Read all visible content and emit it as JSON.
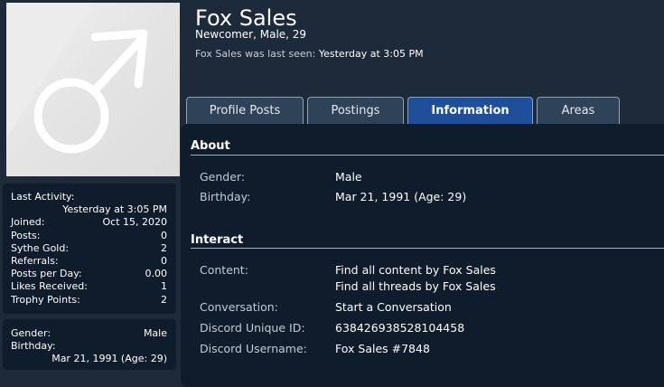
{
  "profile": {
    "name": "Fox Sales",
    "subtitle": "Newcomer, Male, 29",
    "last_seen_label": "Fox Sales was last seen:",
    "last_seen_value": "Yesterday at 3:05 PM",
    "avatar_icon": "male-symbol-icon"
  },
  "stats": {
    "last_activity_label": "Last Activity:",
    "last_activity_value": "Yesterday at 3:05 PM",
    "rows": [
      {
        "label": "Joined:",
        "value": "Oct 15, 2020"
      },
      {
        "label": "Posts:",
        "value": "0"
      },
      {
        "label": "Sythe Gold:",
        "value": "2"
      },
      {
        "label": "Referrals:",
        "value": "0"
      },
      {
        "label": "Posts per Day:",
        "value": "0.00"
      },
      {
        "label": "Likes Received:",
        "value": "1"
      },
      {
        "label": "Trophy Points:",
        "value": "2"
      }
    ]
  },
  "mini": {
    "gender_label": "Gender:",
    "gender_value": "Male",
    "birthday_label": "Birthday:",
    "birthday_value": "Mar 21, 1991 (Age: 29)"
  },
  "tabs": [
    {
      "label": "Profile Posts",
      "active": false
    },
    {
      "label": "Postings",
      "active": false
    },
    {
      "label": "Information",
      "active": true
    },
    {
      "label": "Areas",
      "active": false
    }
  ],
  "about": {
    "title": "About",
    "gender_label": "Gender:",
    "gender_value": "Male",
    "birthday_label": "Birthday:",
    "birthday_value": "Mar 21, 1991 (Age: 29)"
  },
  "interact": {
    "title": "Interact",
    "content_label": "Content:",
    "content_link1": "Find all content by Fox Sales",
    "content_link2": "Find all threads by Fox Sales",
    "conversation_label": "Conversation:",
    "conversation_link": "Start a Conversation",
    "discord_id_label": "Discord Unique ID:",
    "discord_id_value": "638426938528104458",
    "discord_user_label": "Discord Username:",
    "discord_user_value": "Fox Sales #7848"
  },
  "colors": {
    "page_bg": "#1d2a3a",
    "panel_bg": "#0f1c2c",
    "active_tab": "#1e4f98",
    "inactive_tab": "#2f4358"
  }
}
